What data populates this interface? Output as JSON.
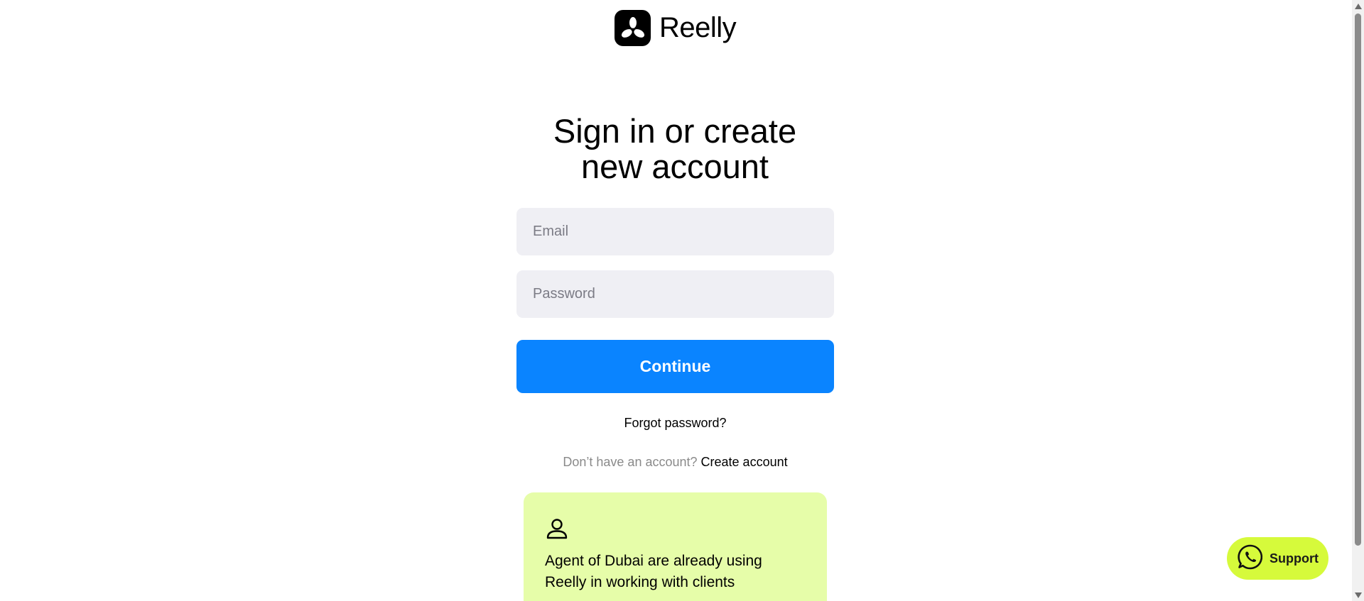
{
  "header": {
    "brand_name": "Reelly"
  },
  "form": {
    "title_line1": "Sign in or create",
    "title_line2": "new account",
    "email_placeholder": "Email",
    "password_placeholder": "Password",
    "continue_label": "Continue",
    "forgot_password_label": "Forgot password?",
    "signup_hint": "Don’t have an account?",
    "create_account_label": "Create account"
  },
  "info_card": {
    "icon": "user-icon",
    "text": "Agent of Dubai are already using Reelly in working with clients"
  },
  "support": {
    "label": "Support",
    "icon": "whatsapp-icon"
  },
  "colors": {
    "primary": "#0a84ff",
    "card_background": "#e6fda9",
    "support_background": "#d6fa3b",
    "input_background": "#efeff4"
  }
}
